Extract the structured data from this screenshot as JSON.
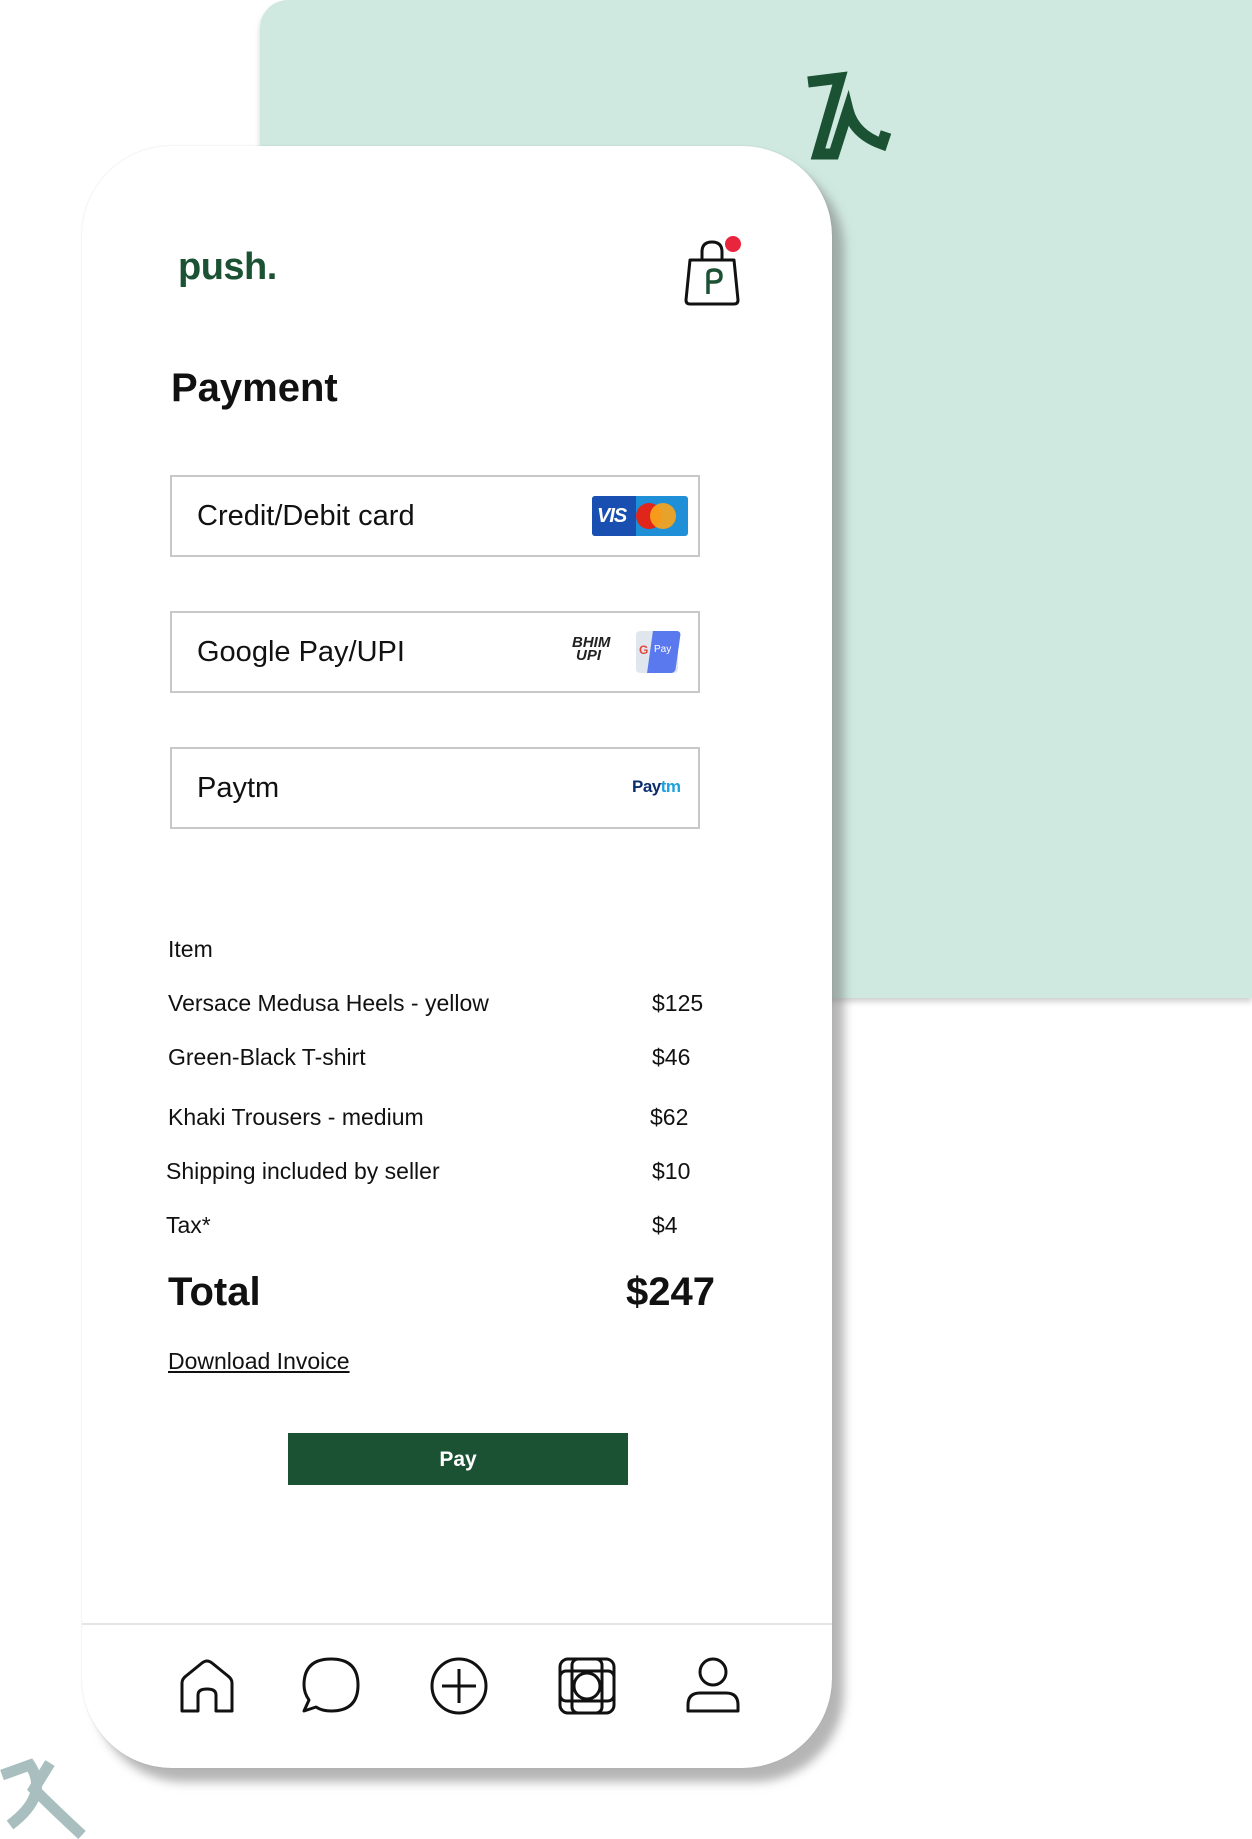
{
  "brand": {
    "name": "push.",
    "color": "#1b5234"
  },
  "header": {
    "cart_icon": "shopping-bag-icon",
    "notification_color": "#e8253c"
  },
  "page": {
    "title": "Payment"
  },
  "payment_options": [
    {
      "label": "Credit/Debit card",
      "logos": [
        "visa-logo",
        "mastercard-logo"
      ],
      "visa_text": "VIS"
    },
    {
      "label": "Google Pay/UPI",
      "logos": [
        "bhim-upi-logo",
        "google-pay-logo"
      ],
      "bhim_text": [
        "BHIM",
        "UPI"
      ],
      "gpay_text": "Pay"
    },
    {
      "label": "Paytm",
      "logos": [
        "paytm-logo"
      ],
      "paytm_text": [
        "Pay",
        "tm"
      ]
    }
  ],
  "summary": {
    "header": "Item",
    "items": [
      {
        "name": "Versace Medusa Heels - yellow",
        "price": "$125"
      },
      {
        "name": "Green-Black T-shirt",
        "price": "$46"
      },
      {
        "name": "Khaki Trousers - medium",
        "price": "$62"
      },
      {
        "name": "Shipping included by seller",
        "price": "$10"
      },
      {
        "name": "Tax*",
        "price": "$4"
      }
    ],
    "total_label": "Total",
    "total_value": "$247"
  },
  "actions": {
    "download_label": "Download Invoice",
    "pay_label": "Pay"
  },
  "tabbar": [
    "home-icon",
    "chat-icon",
    "add-icon",
    "gallery-icon",
    "profile-icon"
  ],
  "colors": {
    "accent": "#1b5234",
    "mint": "#cfe9e1",
    "deco_gray": "#a9bfbf"
  }
}
